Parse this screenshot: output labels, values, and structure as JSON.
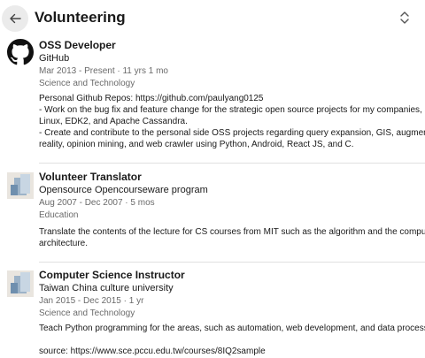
{
  "header": {
    "title": "Volunteering"
  },
  "entries": [
    {
      "role": "OSS Developer",
      "org": "GitHub",
      "dates": "Mar 2013 - Present · 11 yrs 1 mo",
      "cause": "Science and Technology",
      "desc_lines": [
        "Personal Github Repos: https://github.com/paulyang0125",
        "- Work on the bug fix and feature change for the strategic open source projects for my companies, such as",
        "Linux, EDK2, and Apache Cassandra.",
        "- Create and contribute to the personal side OSS projects regarding query expansion, GIS, augmented",
        "reality, opinion mining, and web crawler using Python, Android, React JS, and C."
      ]
    },
    {
      "role": "Volunteer Translator",
      "org": "Opensource Opencourseware program",
      "dates": "Aug 2007 - Dec 2007 · 5 mos",
      "cause": "Education",
      "desc_lines": [
        "Translate the contents of the lecture for CS courses from MIT such as the algorithm and the computer",
        "architecture."
      ]
    },
    {
      "role": "Computer Science Instructor",
      "org": "Taiwan China culture university",
      "dates": "Jan 2015 - Dec 2015 · 1 yr",
      "cause": "Science and Technology",
      "desc_lines": [
        "Teach Python programming for the areas, such as automation, web development, and data processing.",
        "",
        "source: https://www.sce.pccu.edu.tw/courses/8IQ2sample"
      ]
    }
  ]
}
